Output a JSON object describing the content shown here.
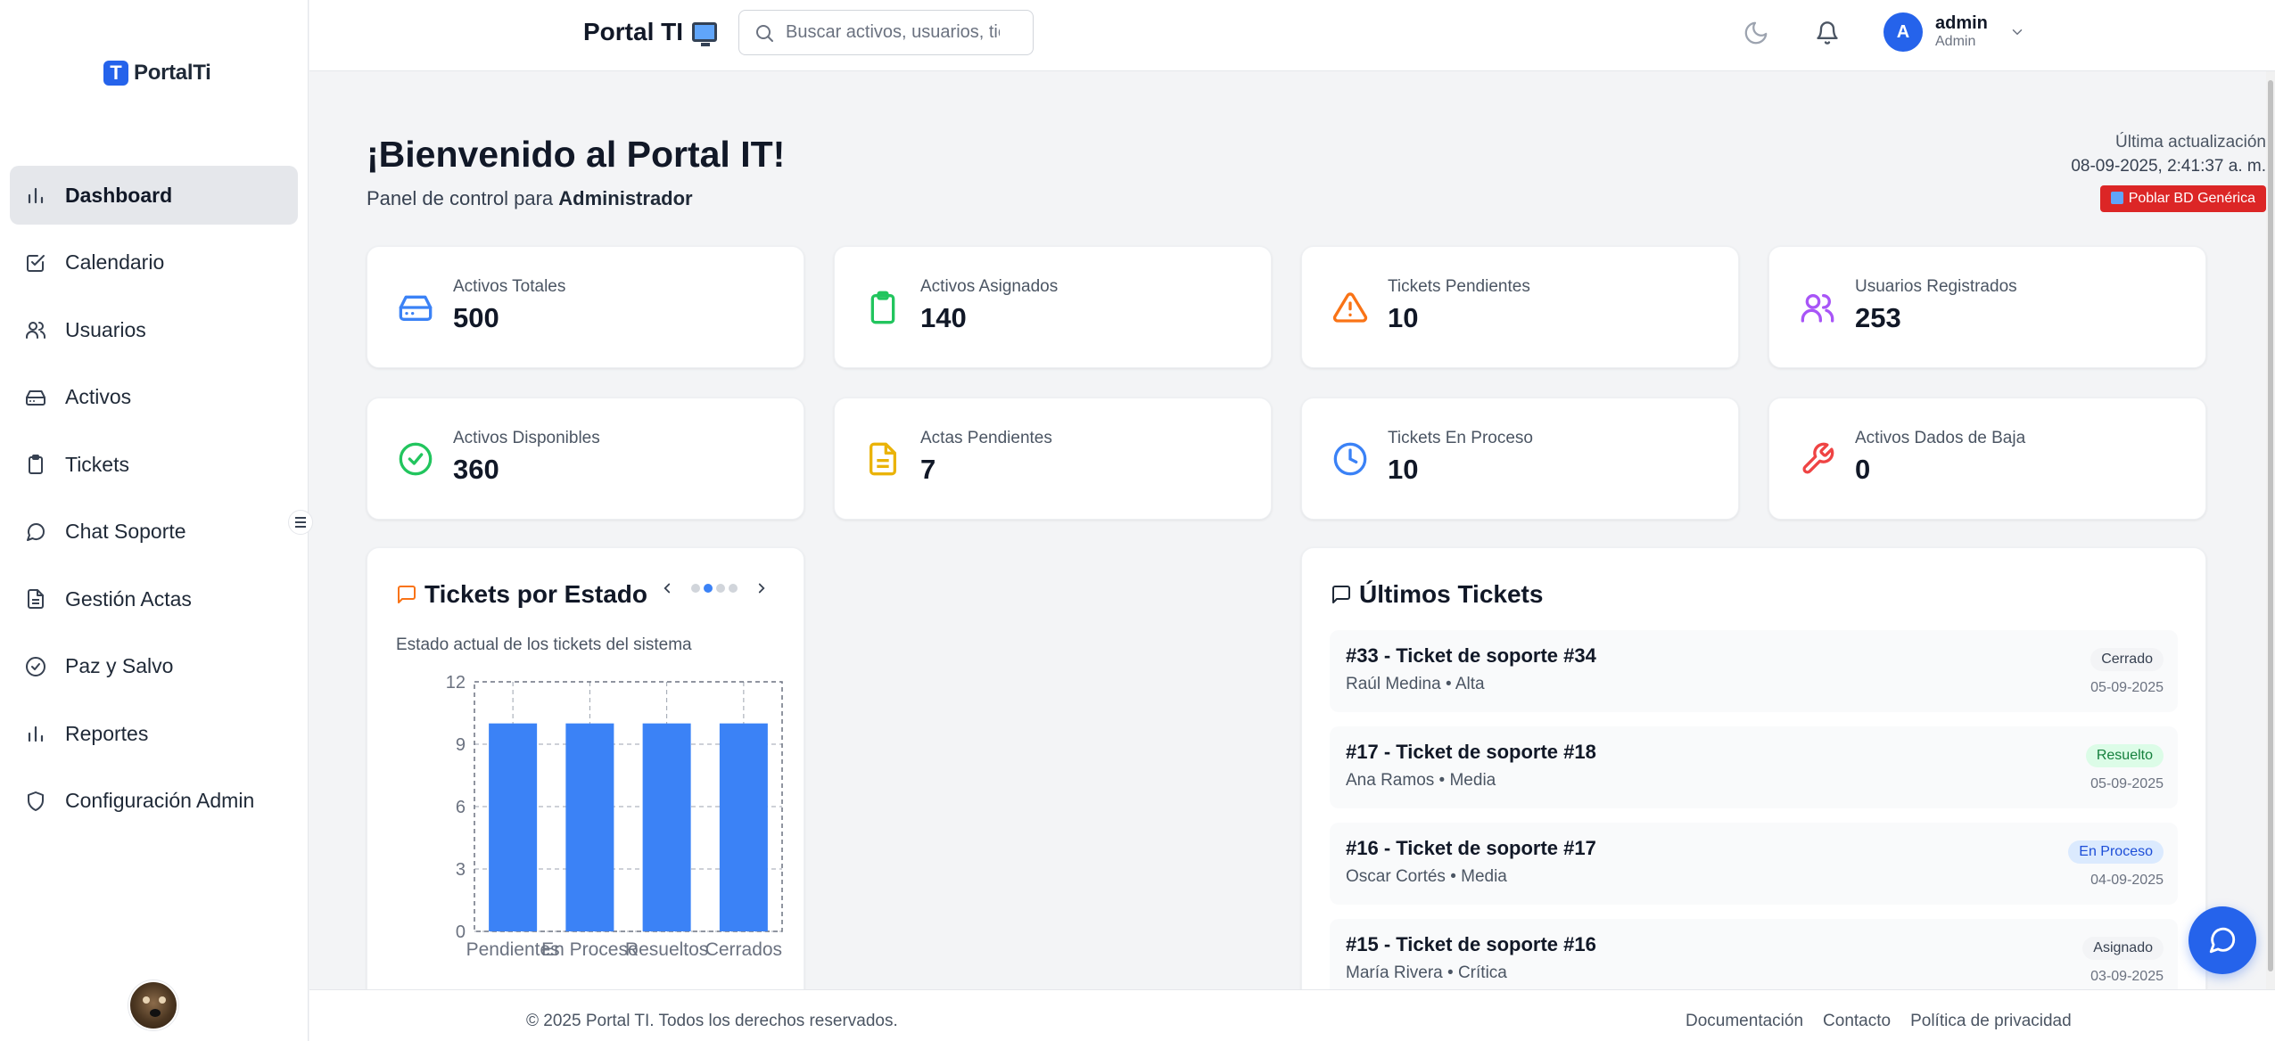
{
  "app": {
    "logo_text": "PortalTi",
    "logo_letter": "T"
  },
  "sidebar": {
    "items": [
      {
        "label": "Dashboard",
        "icon": "bar-chart-icon",
        "active": true
      },
      {
        "label": "Calendario",
        "icon": "calendar-check-icon"
      },
      {
        "label": "Usuarios",
        "icon": "users-icon"
      },
      {
        "label": "Activos",
        "icon": "hard-drive-icon"
      },
      {
        "label": "Tickets",
        "icon": "clipboard-icon"
      },
      {
        "label": "Chat Soporte",
        "icon": "message-circle-icon"
      },
      {
        "label": "Gestión Actas",
        "icon": "file-text-icon"
      },
      {
        "label": "Paz y Salvo",
        "icon": "check-circle-icon"
      },
      {
        "label": "Reportes",
        "icon": "bar-chart-icon"
      },
      {
        "label": "Configuración Admin",
        "icon": "shield-icon"
      }
    ]
  },
  "topbar": {
    "title": "Portal TI",
    "search_placeholder": "Buscar activos, usuarios, tickets...",
    "user": {
      "initial": "A",
      "name": "admin",
      "role": "Admin"
    }
  },
  "welcome": {
    "title": "¡Bienvenido al Portal IT!",
    "subtitle_prefix": "Panel de control para",
    "subtitle_role": "Administrador",
    "update_label": "Última actualización",
    "update_value": "08-09-2025, 2:41:37 a. m.",
    "populate_button": "Poblar BD Genérica"
  },
  "stats": [
    {
      "label": "Activos Totales",
      "value": "500",
      "icon": "hard-drive-icon",
      "color": "#3b82f6"
    },
    {
      "label": "Activos Asignados",
      "value": "140",
      "icon": "clipboard-icon",
      "color": "#22c55e"
    },
    {
      "label": "Tickets Pendientes",
      "value": "10",
      "icon": "alert-triangle-icon",
      "color": "#f97316"
    },
    {
      "label": "Usuarios Registrados",
      "value": "253",
      "icon": "users-icon",
      "color": "#a855f7"
    },
    {
      "label": "Activos Disponibles",
      "value": "360",
      "icon": "check-circle-icon",
      "color": "#22c55e"
    },
    {
      "label": "Actas Pendientes",
      "value": "7",
      "icon": "file-text-icon",
      "color": "#eab308"
    },
    {
      "label": "Tickets En Proceso",
      "value": "10",
      "icon": "clock-icon",
      "color": "#3b82f6"
    },
    {
      "label": "Activos Dados de Baja",
      "value": "0",
      "icon": "wrench-icon",
      "color": "#ef4444"
    }
  ],
  "tickets_chart_panel": {
    "title": "Tickets por Estado",
    "subtitle": "Estado actual de los tickets del sistema",
    "active_slide": 2,
    "slides": 4
  },
  "chart_data": {
    "type": "bar",
    "categories": [
      "Pendientes",
      "En Proceso",
      "Resueltos",
      "Cerrados"
    ],
    "values": [
      10,
      10,
      10,
      10
    ],
    "title": "",
    "xlabel": "",
    "ylabel": "",
    "ylim": [
      0,
      12
    ],
    "yticks": [
      0,
      3,
      6,
      9,
      12
    ],
    "grid": true,
    "color": "#3b82f6"
  },
  "latest_tickets": {
    "title": "Últimos Tickets",
    "items": [
      {
        "title": "#33 - Ticket de soporte #34",
        "meta": "Raúl Medina • Alta",
        "status": "Cerrado",
        "status_bg": "#f3f4f6",
        "status_fg": "#374151",
        "date": "05-09-2025"
      },
      {
        "title": "#17 - Ticket de soporte #18",
        "meta": "Ana Ramos • Media",
        "status": "Resuelto",
        "status_bg": "#dcfce7",
        "status_fg": "#15803d",
        "date": "05-09-2025"
      },
      {
        "title": "#16 - Ticket de soporte #17",
        "meta": "Oscar Cortés • Media",
        "status": "En Proceso",
        "status_bg": "#dbeafe",
        "status_fg": "#1d4ed8",
        "date": "04-09-2025"
      },
      {
        "title": "#15 - Ticket de soporte #16",
        "meta": "María Rivera • Crítica",
        "status": "Asignado",
        "status_bg": "#f3f4f6",
        "status_fg": "#374151",
        "date": "03-09-2025"
      }
    ]
  },
  "footer": {
    "copyright": "© 2025 Portal TI. Todos los derechos reservados.",
    "links": [
      "Documentación",
      "Contacto",
      "Política de privacidad"
    ]
  }
}
